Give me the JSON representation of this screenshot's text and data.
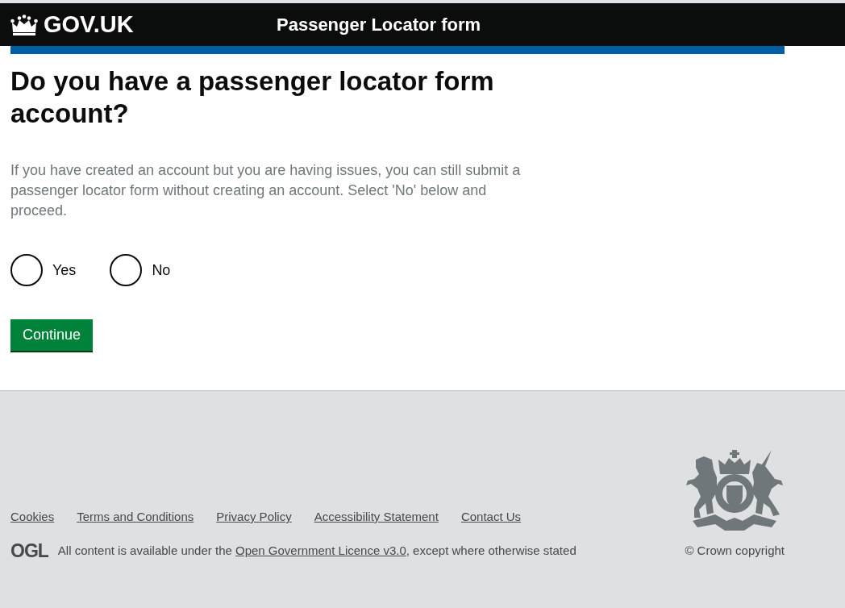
{
  "header": {
    "logo_text": "GOV.UK",
    "service_name": "Passenger Locator form"
  },
  "question": {
    "heading": "Do you have a passenger locator form account?",
    "hint": "If you have created an account but you are having issues, you can still submit a passenger locator form without creating an account. Select 'No' below and proceed."
  },
  "radios": [
    {
      "label": "Yes",
      "selected": false
    },
    {
      "label": "No",
      "selected": false
    }
  ],
  "continue_button": "Continue",
  "footer": {
    "links": [
      "Cookies",
      "Terms and Conditions",
      "Privacy Policy",
      "Accessibility Statement",
      "Contact Us"
    ],
    "ogl_logo": "OGL",
    "licence": {
      "before": "All content is available under the ",
      "link": "Open Government Licence v3.0",
      "after": ", except where otherwise stated"
    },
    "copyright": "© Crown copyright"
  }
}
